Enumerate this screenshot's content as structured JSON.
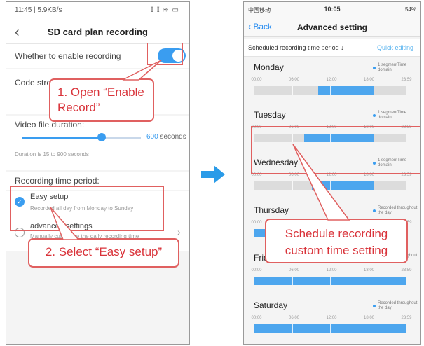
{
  "left_phone": {
    "status_left": "11:45 | 5.9KB/s",
    "status_right": "𝕀 𝕀 ≋ ▭",
    "title": "SD card plan recording",
    "enable_label": "Whether to enable recording",
    "enable_on": true,
    "code_stream_label": "Code stre",
    "video_label": "Video file duration:",
    "duration_value": "600",
    "duration_unit": " seconds",
    "duration_fraction": 0.67,
    "duration_hint": "Duration is 15 to 900 seconds",
    "recording_period_label": "Recording time period:",
    "easy_setup_title": "Easy setup",
    "easy_setup_desc": "Recorded all day from Monday to Sunday",
    "advanced_title": "advanced settings",
    "advanced_desc": "Manually customize the daily recording time period"
  },
  "right_phone": {
    "status_left": "中国移动",
    "status_time": "10:05",
    "status_right": "54%",
    "back_label": "Back",
    "title": "Advanced setting",
    "sub_label": "Scheduled recording time period ↓",
    "quick_edit": "Quick editing",
    "tick_labels": [
      "00:00",
      "06:00",
      "12:00",
      "18:00",
      "23:59"
    ],
    "days": [
      {
        "name": "Monday",
        "note": "1 segmentTime domain",
        "segments": [
          [
            0.42,
            0.79
          ]
        ]
      },
      {
        "name": "Tuesday",
        "note": "1 segmentTime domain",
        "segments": [
          [
            0.33,
            0.79
          ]
        ]
      },
      {
        "name": "Wednesday",
        "note": "1 segmentTime domain",
        "segments": [
          [
            0.38,
            0.79
          ]
        ]
      },
      {
        "name": "Thursday",
        "note": "Recorded throughout the day",
        "segments": [
          [
            0.0,
            1.0
          ]
        ]
      },
      {
        "name": "Friday",
        "note": "Recorded throughout the day",
        "segments": [
          [
            0.0,
            1.0
          ]
        ]
      },
      {
        "name": "Saturday",
        "note": "Recorded throughout the day",
        "segments": [
          [
            0.0,
            1.0
          ]
        ]
      }
    ]
  },
  "callouts": {
    "step1": "1. Open “Enable Record”",
    "step2": "2. Select “Easy setup”",
    "step3": "Schedule recording custom time setting"
  },
  "colors": {
    "accent": "#3a9df0",
    "callout": "#d9333a",
    "highlight": "#e06060"
  }
}
